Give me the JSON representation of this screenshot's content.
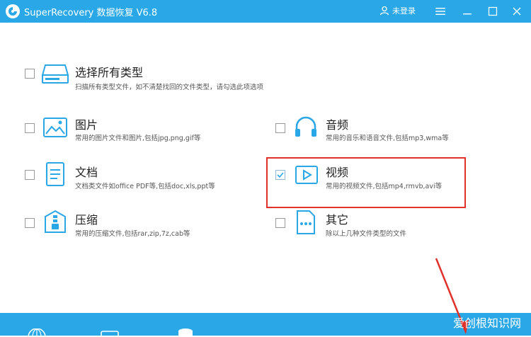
{
  "titlebar": {
    "title": "SuperRecovery 数据恢复 V6.8",
    "login_label": "未登录"
  },
  "options": [
    {
      "key": "all",
      "label": "选择所有类型",
      "desc": "扫描所有类型文件，如不清楚找回的文件类型，请勾选此项选项",
      "checked": false,
      "icon": "hard-drive-icon"
    },
    {
      "key": "image",
      "label": "图片",
      "desc": "常用的图片文件和图片,包括jpg,png,gif等",
      "checked": false,
      "icon": "image-icon"
    },
    {
      "key": "audio",
      "label": "音频",
      "desc": "常用的音乐和语音文件,包括mp3,wma等",
      "checked": false,
      "icon": "headphones-icon"
    },
    {
      "key": "document",
      "label": "文档",
      "desc": "文档类文件如office PDF等,包括doc,xls,ppt等",
      "checked": false,
      "icon": "document-icon"
    },
    {
      "key": "video",
      "label": "视频",
      "desc": "常用的视频文件,包括mp4,rmvb,avi等",
      "checked": true,
      "icon": "video-icon"
    },
    {
      "key": "archive",
      "label": "压缩",
      "desc": "常用的压缩文件,包括rar,zip,7z,cab等",
      "checked": false,
      "icon": "archive-icon"
    },
    {
      "key": "other",
      "label": "其它",
      "desc": "除以上几种文件类型的文件",
      "checked": false,
      "icon": "other-files-icon"
    }
  ],
  "watermark": "爱创根知识网",
  "colors": {
    "titlebar": "#2aa7e6",
    "icon": "#2aa7e6",
    "highlight": "#e0312b",
    "arrow": "#e0312b"
  }
}
